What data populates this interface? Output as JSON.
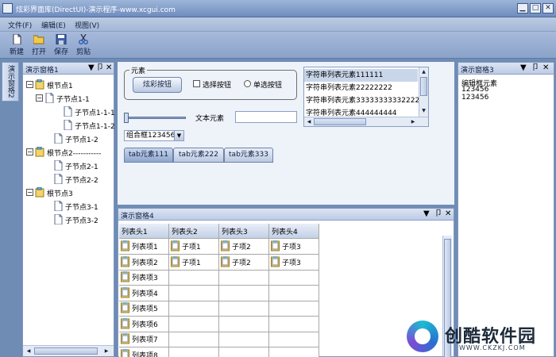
{
  "window": {
    "title": "炫彩界面库(DirectUI)-演示程序-www.xcgui.com",
    "minimize": "▁",
    "maximize": "□",
    "close": "✕"
  },
  "menu": {
    "items": [
      {
        "label": "文件(F)",
        "name": "menu-file"
      },
      {
        "label": "编辑(E)",
        "name": "menu-edit"
      },
      {
        "label": "视图(V)",
        "name": "menu-view"
      }
    ]
  },
  "toolbar": {
    "items": [
      {
        "label": "新建",
        "icon": "new-file-icon"
      },
      {
        "label": "打开",
        "icon": "open-folder-icon"
      },
      {
        "label": "保存",
        "icon": "save-disk-icon"
      },
      {
        "label": "剪贴",
        "icon": "scissors-icon"
      }
    ]
  },
  "side_tab": {
    "label": "演示窗格2"
  },
  "pane1": {
    "title": "演示窗格1",
    "tree": [
      {
        "label": "根节点1",
        "level": 0,
        "expander": "−",
        "type": "folder"
      },
      {
        "label": "子节点1-1",
        "level": 1,
        "expander": "−",
        "type": "doc"
      },
      {
        "label": "子节点1-1-1",
        "level": 2,
        "expander": "",
        "type": "doc"
      },
      {
        "label": "子节点1-1-2",
        "level": 2,
        "expander": "",
        "type": "doc"
      },
      {
        "label": "子节点1-2",
        "level": 1,
        "expander": "",
        "type": "doc"
      },
      {
        "label": "根节点2-----------",
        "level": 0,
        "expander": "−",
        "type": "folder"
      },
      {
        "label": "子节点2-1",
        "level": 1,
        "expander": "",
        "type": "doc"
      },
      {
        "label": "子节点2-2",
        "level": 1,
        "expander": "",
        "type": "doc"
      },
      {
        "label": "根节点3",
        "level": 0,
        "expander": "−",
        "type": "folder"
      },
      {
        "label": "子节点3-1",
        "level": 1,
        "expander": "",
        "type": "doc"
      },
      {
        "label": "子节点3-2",
        "level": 1,
        "expander": "",
        "type": "doc"
      }
    ]
  },
  "pane_buttons": {
    "dropdown": "▼",
    "pin": "卩",
    "close": "✕"
  },
  "elements": {
    "group_title": "元素",
    "fancy_button": "炫彩按钮",
    "checkbox_label": "选择按钮",
    "radio_label": "单选按钮",
    "text_label": "文本元素",
    "text_value": "",
    "combo_value": "组合框123456",
    "combo_arrow": "▼",
    "slider_level": 0,
    "list_items": [
      "字符串列表元素111111",
      "字符串列表元素22222222",
      "字符串列表元素3333333333222222",
      "字符串列表元素444444444"
    ],
    "tabs": [
      "tab元素111",
      "tab元素222",
      "tab元素333"
    ]
  },
  "pane3": {
    "title": "演示窗格3",
    "lines": [
      "编辑框元素",
      "123456",
      "123456"
    ]
  },
  "pane4": {
    "title": "演示窗格4",
    "columns": [
      "列表头1",
      "列表头2",
      "列表头3",
      "列表头4"
    ],
    "rows": [
      [
        "列表项1",
        "子项1",
        "子项2",
        "子项3"
      ],
      [
        "列表项2",
        "子项1",
        "子项2",
        "子项3"
      ],
      [
        "列表项3",
        "",
        "",
        ""
      ],
      [
        "列表项4",
        "",
        "",
        ""
      ],
      [
        "列表项5",
        "",
        "",
        ""
      ],
      [
        "列表项6",
        "",
        "",
        ""
      ],
      [
        "列表项7",
        "",
        "",
        ""
      ],
      [
        "列表项8",
        "",
        "",
        ""
      ]
    ]
  },
  "watermark": {
    "name": "创酷软件园",
    "url": "WWW.CKZKJ.COM"
  },
  "colors": {
    "frame": "#6f8cb5",
    "accent": "#8ea6cd",
    "selection": "#c9d6ea"
  }
}
